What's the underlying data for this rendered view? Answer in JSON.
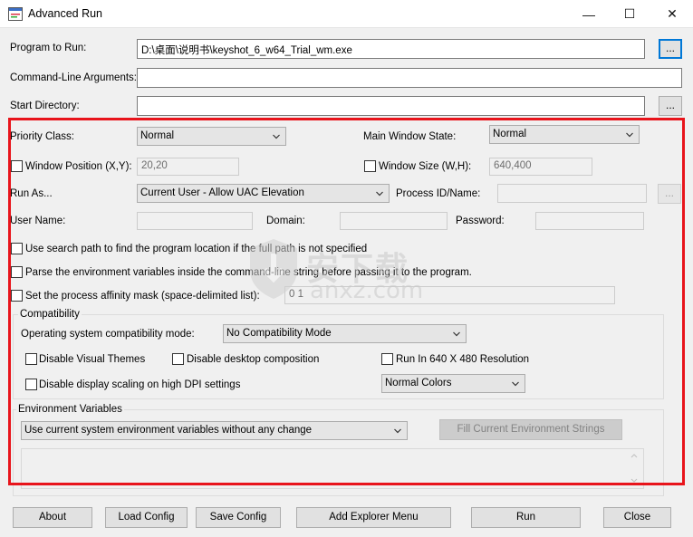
{
  "window": {
    "title": "Advanced Run",
    "minimize_glyph": "—",
    "maximize_glyph": "☐",
    "close_glyph": "✕"
  },
  "program": {
    "label": "Program to Run:",
    "value": "D:\\桌面\\说明书\\keyshot_6_w64_Trial_wm.exe",
    "browse": "..."
  },
  "args": {
    "label": "Command-Line Arguments:",
    "value": ""
  },
  "start_dir": {
    "label": "Start Directory:",
    "value": "",
    "browse": "..."
  },
  "priority": {
    "label": "Priority Class:",
    "value": "Normal"
  },
  "main_window_state": {
    "label": "Main Window State:",
    "value": "Normal"
  },
  "window_position": {
    "label": "Window Position (X,Y):",
    "value": "20,20"
  },
  "window_size": {
    "label": "Window Size (W,H):",
    "value": "640,400"
  },
  "run_as": {
    "label": "Run As...",
    "value": "Current User - Allow UAC Elevation"
  },
  "process_id": {
    "label": "Process ID/Name:",
    "value": "",
    "browse": "..."
  },
  "user_name": {
    "label": "User Name:",
    "value": ""
  },
  "domain": {
    "label": "Domain:",
    "value": ""
  },
  "password": {
    "label": "Password:",
    "value": ""
  },
  "options": {
    "search_path": "Use search path to find the program location if the full path is not specified",
    "parse_env": "Parse the environment variables inside the command-line string before passing it to the program.",
    "affinity": "Set the process affinity mask (space-delimited list):",
    "affinity_value": "0 1"
  },
  "compatibility": {
    "title": "Compatibility",
    "os_label": "Operating system compatibility mode:",
    "os_value": "No Compatibility Mode",
    "disable_visual_themes": "Disable Visual Themes",
    "disable_desktop_composition": "Disable desktop composition",
    "run_640": "Run In 640 X 480 Resolution",
    "disable_dpi": "Disable display scaling on high DPI settings",
    "colors_value": "Normal Colors"
  },
  "environment": {
    "title": "Environment Variables",
    "mode_value": "Use current system environment variables without any change",
    "fill_button": "Fill Current Environment Strings"
  },
  "watermark": {
    "line1": "安下载",
    "line2": "anxz.com"
  },
  "buttons": {
    "about": "About",
    "load_config": "Load Config",
    "save_config": "Save Config",
    "add_explorer_menu": "Add Explorer Menu",
    "run": "Run",
    "close": "Close"
  },
  "colors": {
    "highlight_frame": "#e8141b",
    "accent": "#0078d7"
  }
}
